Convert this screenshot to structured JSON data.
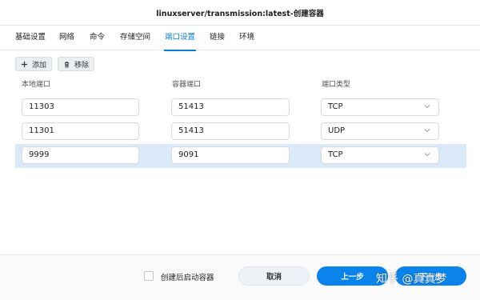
{
  "window": {
    "title": "linuxserver/transmission:latest-创建容器"
  },
  "tabs": [
    {
      "label": "基础设置"
    },
    {
      "label": "网络"
    },
    {
      "label": "命令"
    },
    {
      "label": "存储空间"
    },
    {
      "label": "端口设置",
      "active": true
    },
    {
      "label": "链接"
    },
    {
      "label": "环境"
    }
  ],
  "toolbar": {
    "add_label": "添加",
    "remove_label": "移除"
  },
  "columns": {
    "local_port": "本地端口",
    "container_port": "容器端口",
    "port_type": "端口类型"
  },
  "ports": [
    {
      "local": "11303",
      "container": "51413",
      "type": "TCP",
      "selected": false
    },
    {
      "local": "11301",
      "container": "51413",
      "type": "UDP",
      "selected": false
    },
    {
      "local": "9999",
      "container": "9091",
      "type": "TCP",
      "selected": true
    }
  ],
  "footer": {
    "autostart_label": "创建后启动容器",
    "cancel_label": "取消",
    "prev_label": "上一步",
    "next_label": "下一步"
  },
  "watermark": "知乎 @真真梦",
  "colors": {
    "accent": "#0a7dd8",
    "button_blue": "#0a84ea",
    "selected_row": "#dbe9f8"
  }
}
